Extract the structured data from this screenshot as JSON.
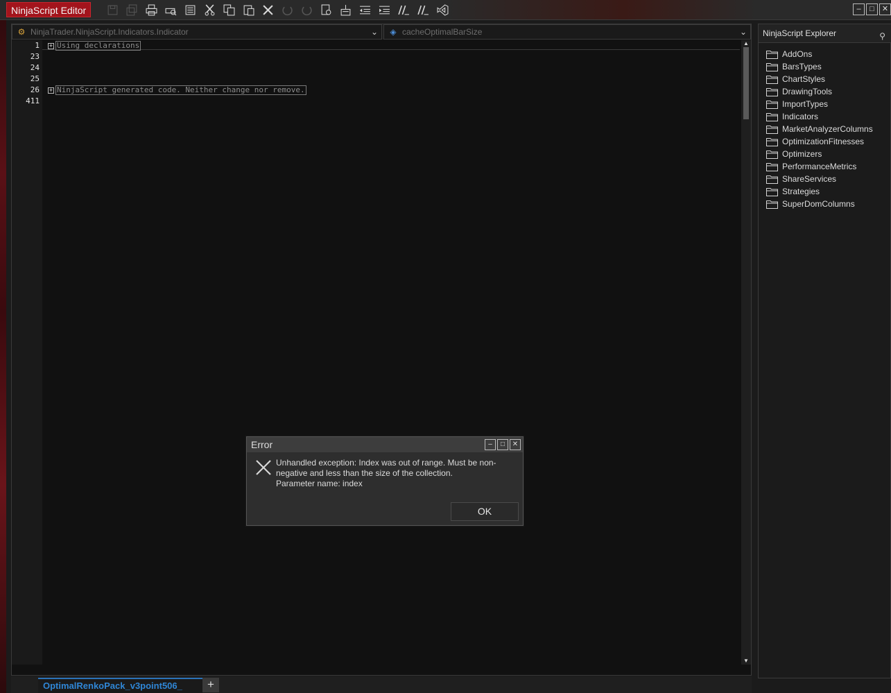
{
  "window": {
    "title": "NinjaScript Editor"
  },
  "toolbar": {
    "buttons": [
      {
        "name": "save-icon",
        "disabled": true
      },
      {
        "name": "save-all-icon",
        "disabled": true
      },
      {
        "name": "print-icon",
        "disabled": false
      },
      {
        "name": "print-preview-icon",
        "disabled": false
      },
      {
        "name": "properties-icon",
        "disabled": false
      },
      {
        "name": "cut-icon",
        "disabled": false
      },
      {
        "name": "copy-icon",
        "disabled": false
      },
      {
        "name": "paste-icon",
        "disabled": false
      },
      {
        "name": "delete-icon",
        "disabled": false
      },
      {
        "name": "undo-icon",
        "disabled": true
      },
      {
        "name": "redo-icon",
        "disabled": true
      },
      {
        "name": "find-icon",
        "disabled": false
      },
      {
        "name": "compile-icon",
        "disabled": false
      },
      {
        "name": "outdent-icon",
        "disabled": false
      },
      {
        "name": "indent-icon",
        "disabled": false
      },
      {
        "name": "comment-icon",
        "disabled": false
      },
      {
        "name": "uncomment-icon",
        "disabled": false
      },
      {
        "name": "visual-studio-icon",
        "disabled": false
      }
    ]
  },
  "editor": {
    "class_combo": "NinjaTrader.NinjaScript.Indicators.Indicator",
    "member_combo": "cacheOptimalBarSize",
    "line_numbers": [
      "1",
      "23",
      "24",
      "25",
      "26",
      "411"
    ],
    "regions": [
      {
        "text": "Using declarations"
      },
      {
        "text": "NinjaScript generated code. Neither change nor remove."
      }
    ],
    "tab": "OptimalRenkoPack_v3point506_",
    "add_tab_label": "+"
  },
  "explorer": {
    "title": "NinjaScript Explorer",
    "folders": [
      "AddOns",
      "BarsTypes",
      "ChartStyles",
      "DrawingTools",
      "ImportTypes",
      "Indicators",
      "MarketAnalyzerColumns",
      "OptimizationFitnesses",
      "Optimizers",
      "PerformanceMetrics",
      "ShareServices",
      "Strategies",
      "SuperDomColumns"
    ]
  },
  "dialog": {
    "title": "Error",
    "message_line1": "Unhandled exception: Index was out of range. Must be non-",
    "message_line2": "negative and less than the size of the collection.",
    "message_line3": "Parameter name: index",
    "ok_label": "OK"
  },
  "colors": {
    "accent": "#a3141c",
    "tab_blue": "#2f86d6"
  }
}
